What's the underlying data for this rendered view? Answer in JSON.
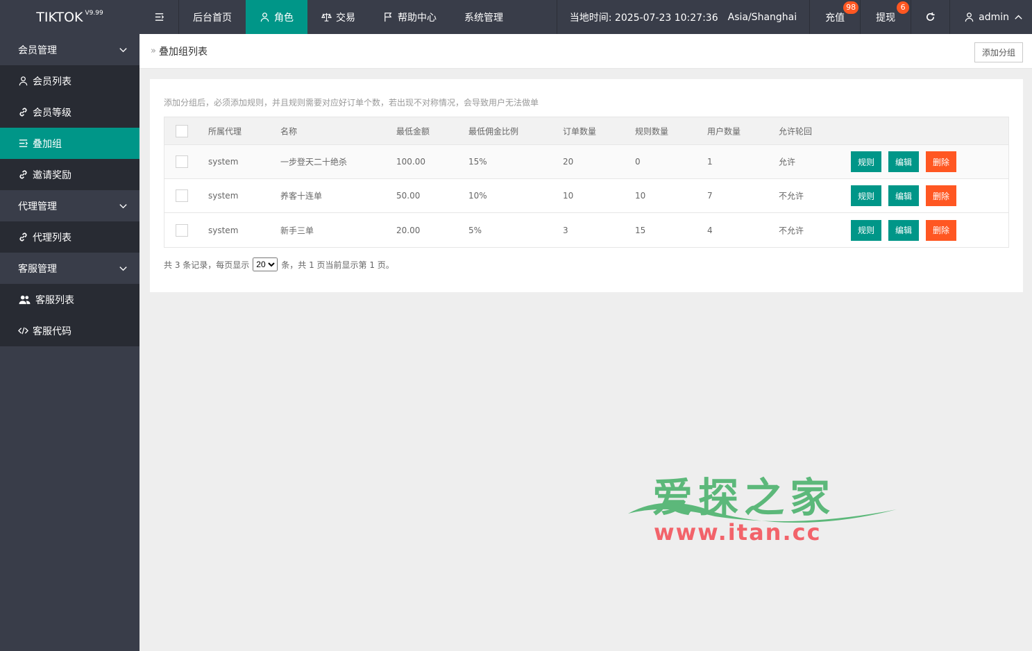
{
  "app": {
    "logo": "TIKTOK",
    "version": "V9.99"
  },
  "topnav": {
    "items": [
      {
        "label": "后台首页"
      },
      {
        "label": "角色"
      },
      {
        "label": "交易"
      },
      {
        "label": "帮助中心"
      },
      {
        "label": "系统管理"
      }
    ],
    "time_label": "当地时间: 2025-07-23 10:27:36",
    "timezone": "Asia/Shanghai",
    "recharge": "充值",
    "recharge_badge": "98",
    "withdraw": "提现",
    "withdraw_badge": "6",
    "user": "admin"
  },
  "sidebar": {
    "groups": [
      {
        "label": "会员管理",
        "items": [
          "会员列表",
          "会员等级",
          "叠加组",
          "邀请奖励"
        ]
      },
      {
        "label": "代理管理",
        "items": [
          "代理列表"
        ]
      },
      {
        "label": "客服管理",
        "items": [
          "客服列表",
          "客服代码"
        ]
      }
    ]
  },
  "page": {
    "breadcrumb": "叠加组列表",
    "add_button": "添加分组",
    "hint": "添加分组后，必须添加规则，并且规则需要对应好订单个数，若出现不对称情况，会导致用户无法做单"
  },
  "table": {
    "columns": [
      "所属代理",
      "名称",
      "最低金额",
      "最低佣金比例",
      "订单数量",
      "规则数量",
      "用户数量",
      "允许轮回"
    ],
    "rows": [
      {
        "agent": "system",
        "name": "一步登天二十绝杀",
        "min_amount": "100.00",
        "min_rate": "15%",
        "orders": "20",
        "rules": "0",
        "users": "1",
        "loop": "允许"
      },
      {
        "agent": "system",
        "name": "养客十连单",
        "min_amount": "50.00",
        "min_rate": "10%",
        "orders": "10",
        "rules": "10",
        "users": "7",
        "loop": "不允许"
      },
      {
        "agent": "system",
        "name": "新手三单",
        "min_amount": "20.00",
        "min_rate": "5%",
        "orders": "3",
        "rules": "15",
        "users": "4",
        "loop": "不允许"
      }
    ],
    "actions": {
      "rule": "规则",
      "edit": "编辑",
      "delete": "删除"
    }
  },
  "pager": {
    "prefix": "共 3 条记录，每页显示",
    "page_size": "20",
    "suffix": "条，共 1 页当前显示第 1 页。"
  },
  "watermark": {
    "cn": "爱探之家",
    "url": "www.itan.cc"
  },
  "colors": {
    "primary": "#009688",
    "danger": "#ff5722",
    "dark": "#393d49"
  }
}
